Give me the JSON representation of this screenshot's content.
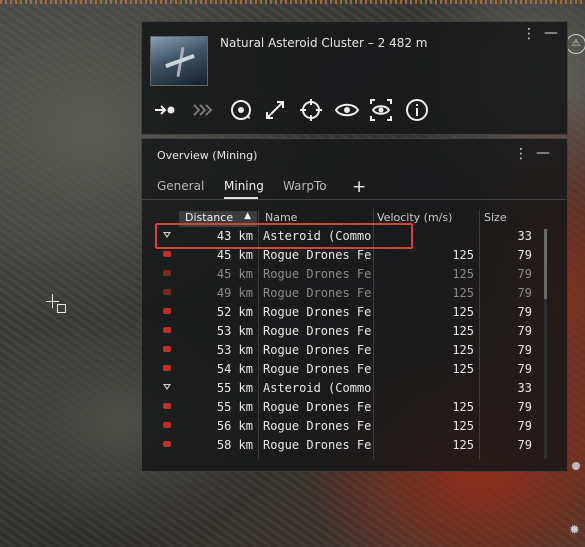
{
  "selected_item": {
    "title": "Natural Asteroid Cluster – 2 482 m",
    "actions": [
      "approach-icon",
      "warp-icon",
      "orbit-icon",
      "keep-at-range-icon",
      "lock-target-icon",
      "look-at-icon",
      "show-info-icon"
    ]
  },
  "overview": {
    "title": "Overview  (Mining)",
    "tabs": [
      "General",
      "Mining",
      "WarpTo"
    ],
    "active_tab": "Mining",
    "columns": {
      "distance": "Distance",
      "name": "Name",
      "velocity": "Velocity (m/s)",
      "size": "Size"
    },
    "rows": [
      {
        "type": "asteroid",
        "distance": "43 km",
        "name": "Asteroid  (Commo",
        "velocity": "",
        "size": "33",
        "dim": false
      },
      {
        "type": "drone",
        "distance": "45 km",
        "name": "Rogue Drones Fer",
        "velocity": "125",
        "size": "79",
        "dim": false
      },
      {
        "type": "drone",
        "distance": "45 km",
        "name": "Rogue Drones Fer",
        "velocity": "125",
        "size": "79",
        "dim": true
      },
      {
        "type": "drone",
        "distance": "49 km",
        "name": "Rogue Drones Fer",
        "velocity": "125",
        "size": "79",
        "dim": true
      },
      {
        "type": "drone",
        "distance": "52 km",
        "name": "Rogue Drones Fer",
        "velocity": "125",
        "size": "79",
        "dim": false
      },
      {
        "type": "drone",
        "distance": "53 km",
        "name": "Rogue Drones Fer",
        "velocity": "125",
        "size": "79",
        "dim": false
      },
      {
        "type": "drone",
        "distance": "53 km",
        "name": "Rogue Drones Fer",
        "velocity": "125",
        "size": "79",
        "dim": false
      },
      {
        "type": "drone",
        "distance": "54 km",
        "name": "Rogue Drones Fer",
        "velocity": "125",
        "size": "79",
        "dim": false
      },
      {
        "type": "asteroid",
        "distance": "55 km",
        "name": "Asteroid  (Commo",
        "velocity": "",
        "size": "33",
        "dim": false
      },
      {
        "type": "drone",
        "distance": "55 km",
        "name": "Rogue Drones Fer",
        "velocity": "125",
        "size": "79",
        "dim": false
      },
      {
        "type": "drone",
        "distance": "56 km",
        "name": "Rogue Drones Fer",
        "velocity": "125",
        "size": "79",
        "dim": false
      },
      {
        "type": "drone",
        "distance": "58 km",
        "name": "Rogue Drones Fer",
        "velocity": "125",
        "size": "79",
        "dim": false
      }
    ]
  },
  "colors": {
    "hostile": "#c0302a",
    "highlight": "#d9403d"
  }
}
